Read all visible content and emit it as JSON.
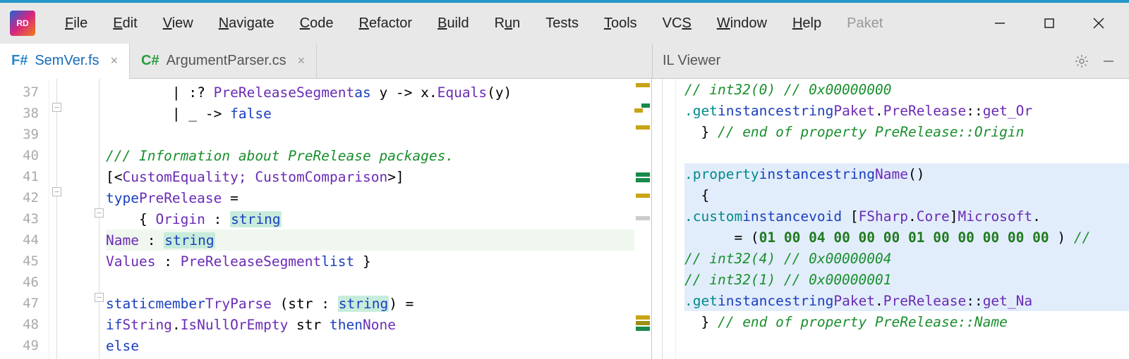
{
  "app": {
    "icon_label": "RD"
  },
  "menu": {
    "file": "File",
    "edit": "Edit",
    "view": "View",
    "navigate": "Navigate",
    "code": "Code",
    "refactor": "Refactor",
    "build": "Build",
    "run": "Run",
    "tests": "Tests",
    "tools": "Tools",
    "vcs": "VCS",
    "window": "Window",
    "help": "Help",
    "paket": "Paket"
  },
  "tabs": [
    {
      "lang": "F#",
      "name": "SemVer.fs",
      "active": true
    },
    {
      "lang": "C#",
      "name": "ArgumentParser.cs",
      "active": false
    }
  ],
  "right_panel": {
    "title": "IL Viewer"
  },
  "editor": {
    "line_start": 37,
    "lines": [
      "        | :? PreReleaseSegment as y -> x.Equals(y)",
      "        | _ -> false",
      "",
      "/// Information about PreRelease packages.",
      "[<CustomEquality; CustomComparison>]",
      "type PreRelease =",
      "    { Origin : string",
      "      Name : string",
      "      Values : PreReleaseSegment list }",
      "",
      "    static member TryParse (str : string) =",
      "        if String.IsNullOrEmpty str then None",
      "        else"
    ],
    "current_line": 44
  },
  "il_viewer": {
    "lines": [
      {
        "indent": 3,
        "text": "// int32(4) // 0x00000004",
        "cls": "comm",
        "hidden": true
      },
      {
        "indent": 3,
        "text": "// int32(0) // 0x00000000",
        "cls": "comm"
      },
      {
        "indent": 2,
        "text": ".get instance string Paket.PreRelease::get_Or",
        "cls": "get"
      },
      {
        "indent": 1,
        "text": "} // end of property PreRelease::Origin",
        "cls": "endcomm"
      },
      {
        "indent": 0,
        "text": "",
        "cls": "blank"
      },
      {
        "indent": 1,
        "text": ".property instance string Name()",
        "cls": "prop",
        "hl": true
      },
      {
        "indent": 1,
        "text": "{",
        "cls": "brace",
        "hl": true
      },
      {
        "indent": 2,
        "text": ".custom instance void [FSharp.Core]Microsoft.",
        "cls": "custom",
        "hl": true
      },
      {
        "indent": 3,
        "text": "= (01 00 04 00 00 00 01 00 00 00 00 00 ) //",
        "cls": "bytes",
        "hl": true
      },
      {
        "indent": 3,
        "text": "// int32(4) // 0x00000004",
        "cls": "comm",
        "hl": true
      },
      {
        "indent": 3,
        "text": "// int32(1) // 0x00000001",
        "cls": "comm",
        "hl": true
      },
      {
        "indent": 2,
        "text": ".get instance string Paket.PreRelease::get_Na",
        "cls": "get",
        "hl": true
      },
      {
        "indent": 1,
        "text": "} // end of property PreRelease::Name",
        "cls": "endcomm"
      }
    ]
  }
}
